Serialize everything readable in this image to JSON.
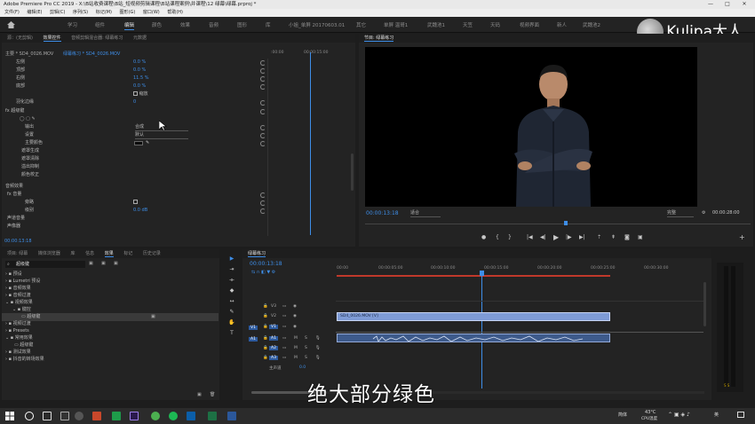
{
  "window": {
    "title": "Adobe Premiere Pro CC 2019 - X:\\B站收费课程\\B站_短视频剪辑课程\\B站课程案例\\并课程\\12 绿幕\\绿幕.prproj *",
    "minimize": "—",
    "maximize": "□",
    "close": "✕"
  },
  "menu": [
    "文件(F)",
    "编辑(E)",
    "剪辑(C)",
    "序列(S)",
    "标记(M)",
    "图形(G)",
    "窗口(W)",
    "帮助(H)"
  ],
  "workspaces": [
    "学习",
    "组件",
    "编辑",
    "颜色",
    "效果",
    "音频",
    "图形",
    "库",
    "小姐_单屏 20170603.01",
    "其它",
    "单屏 温哥1",
    "武魏池1",
    "天笠",
    "天码",
    "视频界面",
    "新人",
    "武魏池2"
  ],
  "active_workspace": "编辑",
  "brand": {
    "name": "Kulipa大人"
  },
  "effect_controls": {
    "tabs": [
      "源：(无剪辑)",
      "效果控件",
      "音频剪辑混合器: 绿幕练习",
      "元数据"
    ],
    "active_tab": "效果控件",
    "master_label": "主要 * SD4_0026.MOV",
    "clip_label": "绿幕练习 * SD4_0026.MOV",
    "ruler_start": ":00:00",
    "ruler_time": "00:00:15:00",
    "rows": [
      {
        "name": "左侧",
        "value": "0.0 %"
      },
      {
        "name": "顶部",
        "value": "0.0 %"
      },
      {
        "name": "右侧",
        "value": "11.5 %"
      },
      {
        "name": "底部",
        "value": "0.0 %"
      },
      {
        "name": "",
        "value": "缩放"
      },
      {
        "name": "羽化边缘",
        "value": "0"
      },
      {
        "name": "超级键",
        "value": ""
      },
      {
        "name": "输出",
        "value": "合成"
      },
      {
        "name": "设置",
        "value": "默认"
      },
      {
        "name": "主要颜色",
        "value": ""
      },
      {
        "name": "遮罩生成",
        "value": ""
      },
      {
        "name": "遮罩清除",
        "value": ""
      },
      {
        "name": "溢出抑制",
        "value": ""
      },
      {
        "name": "颜色校正",
        "value": ""
      },
      {
        "name": "音频效果",
        "value": ""
      },
      {
        "name": "音量",
        "value": ""
      },
      {
        "name": "旁路",
        "value": ""
      },
      {
        "name": "级别",
        "value": "0.0 dB"
      },
      {
        "name": "声道音量",
        "value": ""
      },
      {
        "name": "声像器",
        "value": ""
      }
    ],
    "current_time": "00:00:13:18"
  },
  "program": {
    "title": "节目: 绿幕练习",
    "timecode": "00:00:13:18",
    "fit": "适合",
    "quality": "完整",
    "duration": "00:00:28:00"
  },
  "project": {
    "tabs": [
      "项目: 绿幕",
      "媒体浏览器",
      "库",
      "信息",
      "效果",
      "标记",
      "历史记录"
    ],
    "active_tab": "效果",
    "search_value": "超级键",
    "tree": [
      {
        "label": "预设",
        "level": 0
      },
      {
        "label": "Lumetri 预设",
        "level": 0
      },
      {
        "label": "音频效果",
        "level": 0
      },
      {
        "label": "音频过渡",
        "level": 0
      },
      {
        "label": "视频效果",
        "level": 0
      },
      {
        "label": "键控",
        "level": 1
      },
      {
        "label": "超级键",
        "level": 2,
        "selected": true
      },
      {
        "label": "视频过渡",
        "level": 0
      },
      {
        "label": "Presets",
        "level": 0
      },
      {
        "label": "常用效果",
        "level": 0
      },
      {
        "label": "超级键",
        "level": 1
      },
      {
        "label": "测试效果",
        "level": 0
      },
      {
        "label": "抖音的转场效果",
        "level": 0
      }
    ]
  },
  "timeline": {
    "tab": "绿幕练习",
    "timecode": "00:00:13:18",
    "ruler": [
      "00:00",
      "00:00:05:00",
      "00:00:10:00",
      "00:00:15:00",
      "00:00:20:00",
      "00:00:25:00",
      "00:00:30:00"
    ],
    "video_tracks": [
      "V3",
      "V2",
      "V1"
    ],
    "audio_tracks": [
      "A1",
      "A2",
      "A3"
    ],
    "master": "主声道",
    "master_value": "0.0",
    "video_clip": "SD4_0026.MOV [V]",
    "source_v": "V1",
    "source_a": "A1"
  },
  "subtitle": "绝大部分绿色",
  "taskbar": {
    "weather": "43°C",
    "weather_label": "CPU温度",
    "ime": "英",
    "lang": "简体"
  }
}
